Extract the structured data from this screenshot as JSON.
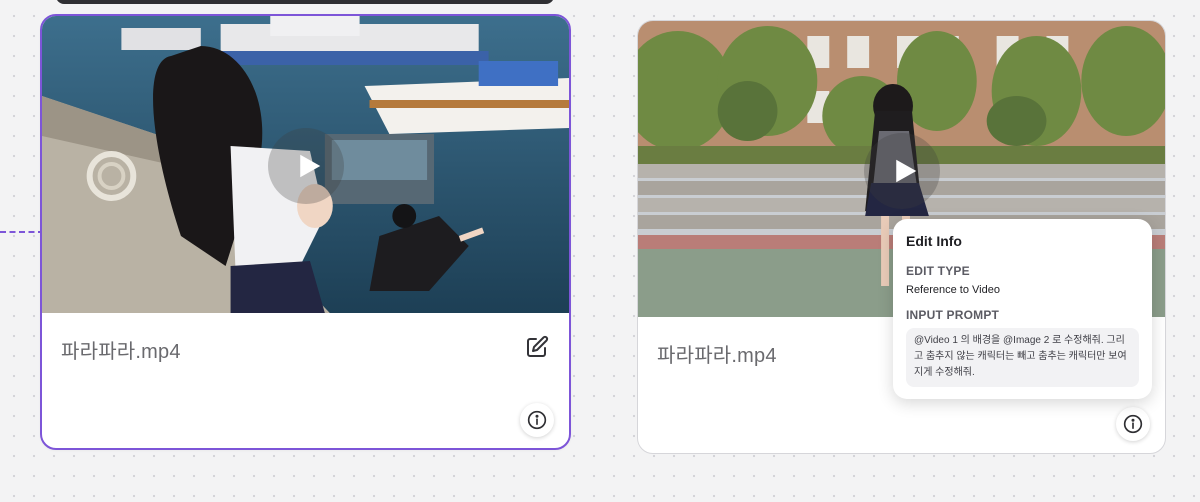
{
  "cards": [
    {
      "filename": "파라파라.mp4",
      "selected": true,
      "icons": {
        "play": "play-icon",
        "edit": "edit-icon",
        "info": "info-icon"
      }
    },
    {
      "filename": "파라파라.mp4",
      "selected": false,
      "icons": {
        "play": "play-icon",
        "info": "info-icon"
      }
    }
  ],
  "edit_info": {
    "title": "Edit Info",
    "edit_type_label": "EDIT TYPE",
    "edit_type_value": "Reference to Video",
    "input_prompt_label": "INPUT PROMPT",
    "input_prompt_value": "@Video 1 의 배경을 @Image 2 로 수정해줘. 그리고 춤추지 않는 캐릭터는 빼고 춤추는 캐릭터만 보여지게 수정해줘."
  },
  "colors": {
    "accent": "#7d55d8",
    "background": "#f3f3f4",
    "card": "#ffffff",
    "text_muted": "#6a6a6e"
  }
}
